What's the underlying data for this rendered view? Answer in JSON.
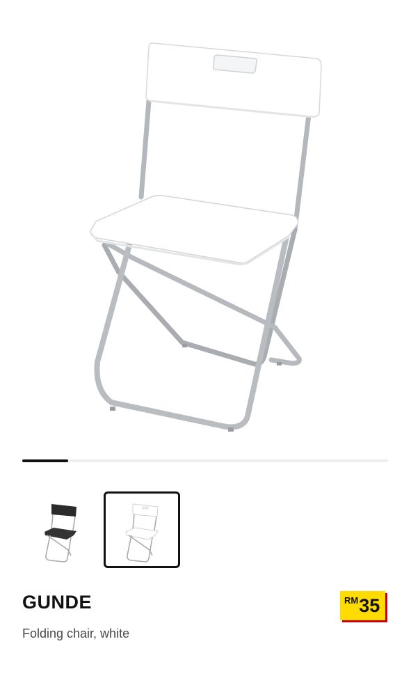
{
  "product": {
    "name": "GUNDE",
    "description": "Folding chair, white",
    "price": {
      "currency": "RM",
      "value": "35"
    }
  },
  "gallery": {
    "main_image": "folding-chair-white",
    "active_index": 0,
    "image_count": 8
  },
  "variants": [
    {
      "color": "black",
      "icon": "folding-chair-black",
      "selected": false
    },
    {
      "color": "white",
      "icon": "folding-chair-white",
      "selected": true
    }
  ],
  "colors": {
    "price_tag_bg": "#ffdb00",
    "price_tag_shadow": "#cc0008",
    "text_primary": "#111111",
    "text_secondary": "#484848"
  }
}
